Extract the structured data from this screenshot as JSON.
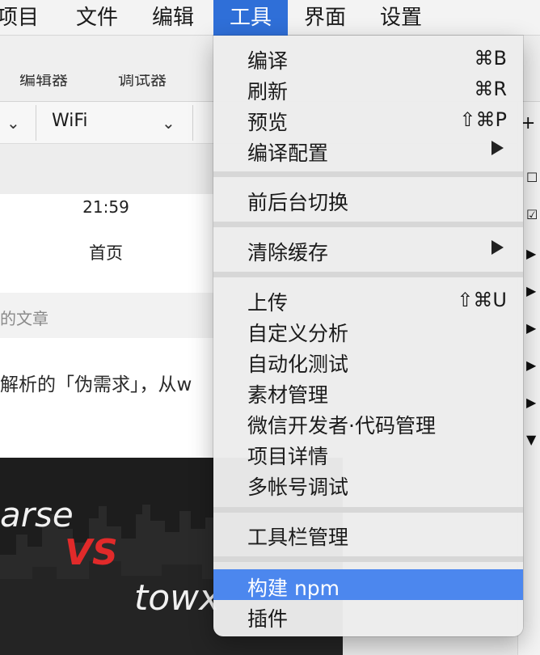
{
  "menubar": {
    "items": [
      {
        "label": "项目"
      },
      {
        "label": "文件"
      },
      {
        "label": "编辑"
      },
      {
        "label": "工具"
      },
      {
        "label": "界面"
      },
      {
        "label": "设置"
      }
    ],
    "active_index": 3
  },
  "toolbar": {
    "editor_label": "编辑器",
    "debugger_label": "调试器"
  },
  "selectors": {
    "network": "WiFi"
  },
  "simulator": {
    "status_time": "21:59",
    "nav_title": "首页",
    "section_label": "的文章",
    "excerpt": "解析的「伪需求」，从w",
    "hero": {
      "word1": "arse",
      "vs": "VS",
      "word2": "towx"
    }
  },
  "tools_menu": {
    "groups": [
      [
        {
          "label": "编译",
          "shortcut": "⌘B"
        },
        {
          "label": "刷新",
          "shortcut": "⌘R"
        },
        {
          "label": "预览",
          "shortcut": "⇧⌘P"
        },
        {
          "label": "编译配置",
          "submenu": true
        }
      ],
      [
        {
          "label": "前后台切换"
        }
      ],
      [
        {
          "label": "清除缓存",
          "submenu": true
        }
      ],
      [
        {
          "label": "上传",
          "shortcut": "⇧⌘U"
        },
        {
          "label": "自定义分析"
        },
        {
          "label": "自动化测试"
        },
        {
          "label": "素材管理"
        },
        {
          "label": "微信开发者·代码管理"
        },
        {
          "label": "项目详情"
        },
        {
          "label": "多帐号调试"
        }
      ],
      [
        {
          "label": "工具栏管理"
        }
      ],
      [
        {
          "label": "构建 npm",
          "highlighted": true
        },
        {
          "label": "插件"
        }
      ]
    ]
  },
  "colors": {
    "menubar_active": "#2f6fd8",
    "menu_highlight": "#4c87ee",
    "hero_vs": "#e12a2a"
  }
}
